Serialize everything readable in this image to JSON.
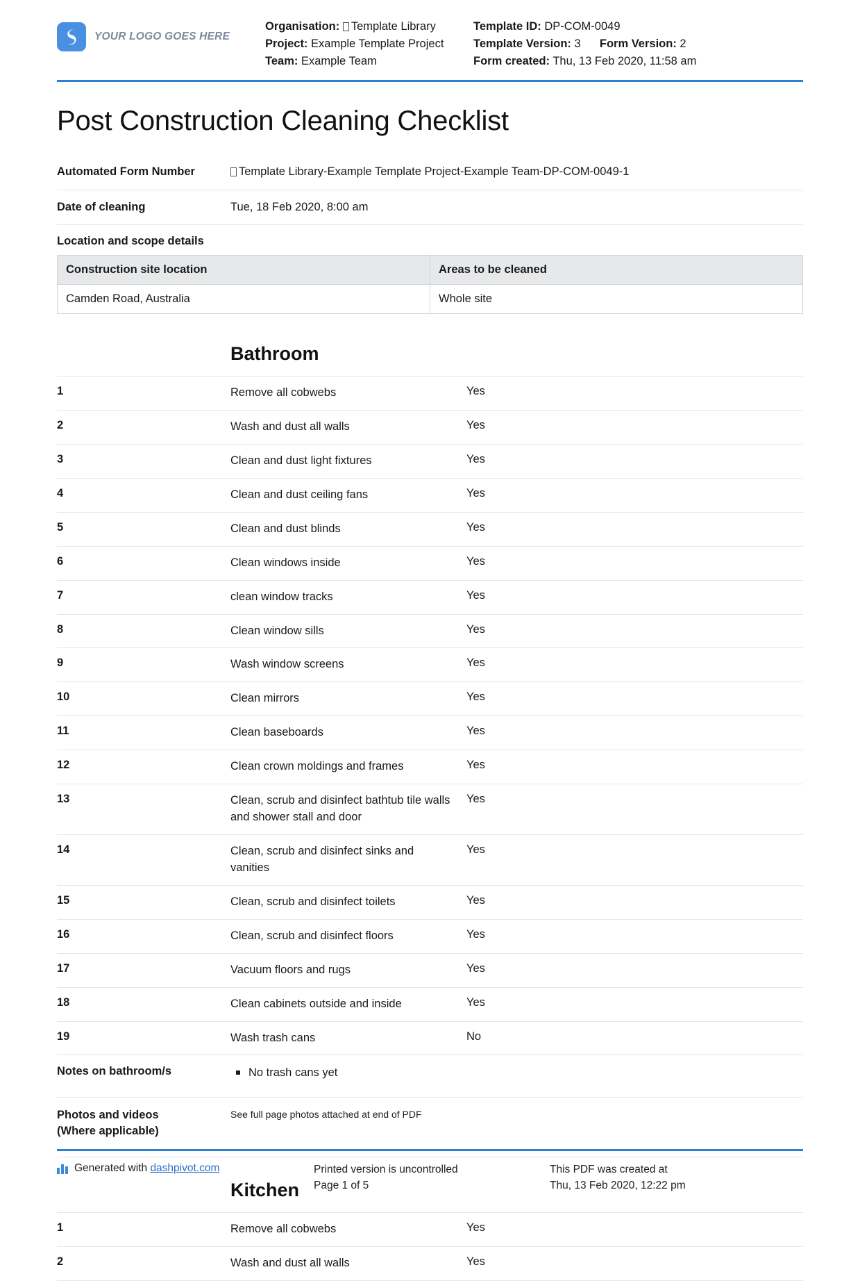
{
  "header": {
    "logo_text": "YOUR LOGO GOES HERE",
    "organisation_label": "Organisation:",
    "organisation_value": "Template Library",
    "project_label": "Project:",
    "project_value": "Example Template Project",
    "team_label": "Team:",
    "team_value": "Example Team",
    "template_id_label": "Template ID:",
    "template_id_value": "DP-COM-0049",
    "template_version_label": "Template Version:",
    "template_version_value": "3",
    "form_version_label": "Form Version:",
    "form_version_value": "2",
    "form_created_label": "Form created:",
    "form_created_value": "Thu, 13 Feb 2020, 11:58 am"
  },
  "title": "Post Construction Cleaning Checklist",
  "fields": {
    "automated_form_number_label": "Automated Form Number",
    "automated_form_number_value": "Template Library-Example Template Project-Example Team-DP-COM-0049-1",
    "date_of_cleaning_label": "Date of cleaning",
    "date_of_cleaning_value": "Tue, 18 Feb 2020, 8:00 am",
    "location_scope_label": "Location and scope details"
  },
  "location_table": {
    "headers": [
      "Construction site location",
      "Areas to be cleaned"
    ],
    "rows": [
      [
        "Camden Road, Australia",
        "Whole site"
      ]
    ]
  },
  "sections": [
    {
      "heading": "Bathroom",
      "items": [
        {
          "num": "1",
          "task": "Remove all cobwebs",
          "answer": "Yes"
        },
        {
          "num": "2",
          "task": "Wash and dust all walls",
          "answer": "Yes"
        },
        {
          "num": "3",
          "task": "Clean and dust light fixtures",
          "answer": "Yes"
        },
        {
          "num": "4",
          "task": "Clean and dust ceiling fans",
          "answer": "Yes"
        },
        {
          "num": "5",
          "task": "Clean and dust blinds",
          "answer": "Yes"
        },
        {
          "num": "6",
          "task": "Clean windows inside",
          "answer": "Yes"
        },
        {
          "num": "7",
          "task": "clean window tracks",
          "answer": "Yes"
        },
        {
          "num": "8",
          "task": "Clean window sills",
          "answer": "Yes"
        },
        {
          "num": "9",
          "task": "Wash window screens",
          "answer": "Yes"
        },
        {
          "num": "10",
          "task": "Clean mirrors",
          "answer": "Yes"
        },
        {
          "num": "11",
          "task": "Clean baseboards",
          "answer": "Yes"
        },
        {
          "num": "12",
          "task": "Clean crown moldings and frames",
          "answer": "Yes"
        },
        {
          "num": "13",
          "task": "Clean, scrub and disinfect bathtub tile walls and shower stall and door",
          "answer": "Yes"
        },
        {
          "num": "14",
          "task": "Clean, scrub and disinfect sinks and vanities",
          "answer": "Yes"
        },
        {
          "num": "15",
          "task": "Clean, scrub and disinfect toilets",
          "answer": "Yes"
        },
        {
          "num": "16",
          "task": "Clean, scrub and disinfect floors",
          "answer": "Yes"
        },
        {
          "num": "17",
          "task": "Vacuum floors and rugs",
          "answer": "Yes"
        },
        {
          "num": "18",
          "task": "Clean cabinets outside and inside",
          "answer": "Yes"
        },
        {
          "num": "19",
          "task": "Wash trash cans",
          "answer": "No"
        }
      ],
      "notes_label": "Notes on bathroom/s",
      "notes": [
        "No trash cans yet"
      ],
      "photos_label_line1": "Photos and videos",
      "photos_label_line2": "(Where applicable)",
      "photos_value": "See full page photos attached at end of PDF"
    },
    {
      "heading": "Kitchen",
      "items": [
        {
          "num": "1",
          "task": "Remove all cobwebs",
          "answer": "Yes"
        },
        {
          "num": "2",
          "task": "Wash and dust all walls",
          "answer": "Yes"
        }
      ]
    }
  ],
  "footer": {
    "generated_prefix": "Generated with",
    "generated_link": "dashpivot.com",
    "printed_line1": "Printed version is uncontrolled",
    "printed_line2": "Page 1 of 5",
    "created_line1": "This PDF was created at",
    "created_line2": "Thu, 13 Feb 2020, 12:22 pm"
  },
  "colors": {
    "accent": "#2f7fd1",
    "logo": "#4a90e2",
    "link": "#2f6fc4",
    "table_header_bg": "#e7e8ea"
  }
}
